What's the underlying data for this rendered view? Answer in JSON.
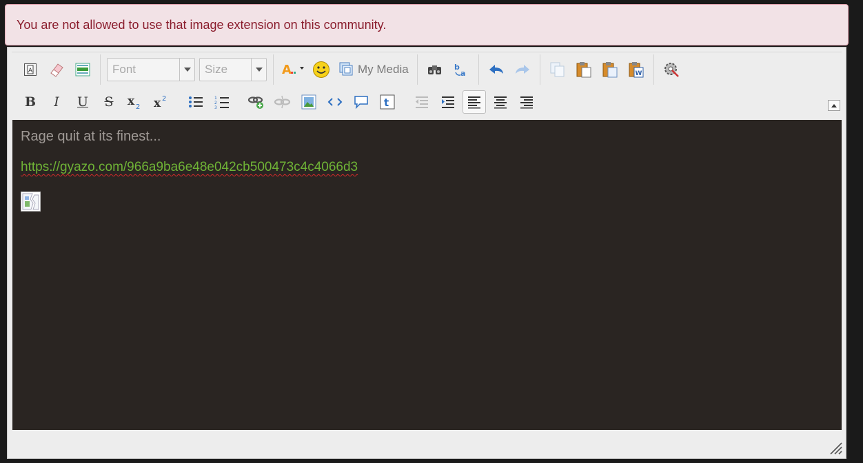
{
  "alert": {
    "message": "You are not allowed to use that image extension on this community."
  },
  "toolbar": {
    "font_placeholder": "Font",
    "size_placeholder": "Size",
    "my_media_label": "My Media"
  },
  "content": {
    "line1": "Rage quit at its finest...",
    "link": "https://gyazo.com/966a9ba6e48e042cb500473c4c4066d3"
  },
  "colors": {
    "alert_bg": "#f2e2e6",
    "alert_text": "#8a1c2c",
    "editor_bg": "#2a2522",
    "link": "#6fb336"
  }
}
